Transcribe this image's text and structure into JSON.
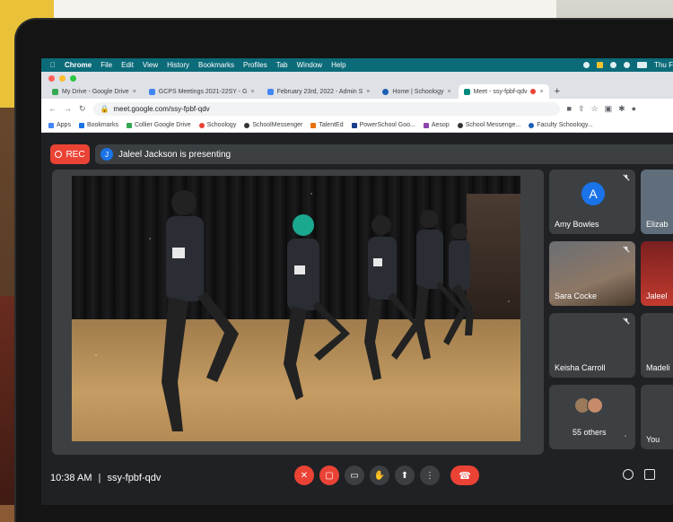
{
  "menubar": {
    "apple": "",
    "items": [
      "Chrome",
      "File",
      "Edit",
      "View",
      "History",
      "Bookmarks",
      "Profiles",
      "Tab",
      "Window",
      "Help"
    ],
    "clock": "Thu F"
  },
  "tabs": [
    {
      "label": "My Drive - Google Drive",
      "color": "#34a853"
    },
    {
      "label": "GCPS Meetings 2021-22SY - G",
      "color": "#4285f4"
    },
    {
      "label": "February 23rd, 2022 - Admin S",
      "color": "#4285f4"
    },
    {
      "label": "Home | Schoology",
      "color": "#1a5fb4"
    },
    {
      "label": "Meet - ssy-fpbf-qdv",
      "color": "#00897b",
      "active": true
    }
  ],
  "address": {
    "url": "meet.google.com/ssy-fpbf-qdv"
  },
  "bookmarks": [
    "Apps",
    "Bookmarks",
    "Collier Google Drive",
    "Schoology",
    "SchoolMessenger",
    "TalentEd",
    "PowerSchool Goo...",
    "Aesop",
    "School Messenge...",
    "Faculty Schoology..."
  ],
  "meet": {
    "rec_label": "REC",
    "presenter_initial": "J",
    "presenting_text": "Jaleel Jackson is presenting",
    "time": "10:38 AM",
    "separator": "|",
    "meeting_code": "ssy-fpbf-qdv",
    "participants": [
      {
        "name": "Amy Bowles",
        "initial": "A"
      },
      {
        "name": "Elizab"
      },
      {
        "name": "Sara Cocke"
      },
      {
        "name": "Jaleel"
      },
      {
        "name": "Keisha Carroll"
      },
      {
        "name": "Madeli"
      },
      {
        "name": "55 others"
      },
      {
        "name": "You"
      }
    ]
  },
  "colors": {
    "meet_bg": "#202124",
    "tile_bg": "#3c4043",
    "red": "#ea4335",
    "teal_menubar": "#0b6b79"
  }
}
